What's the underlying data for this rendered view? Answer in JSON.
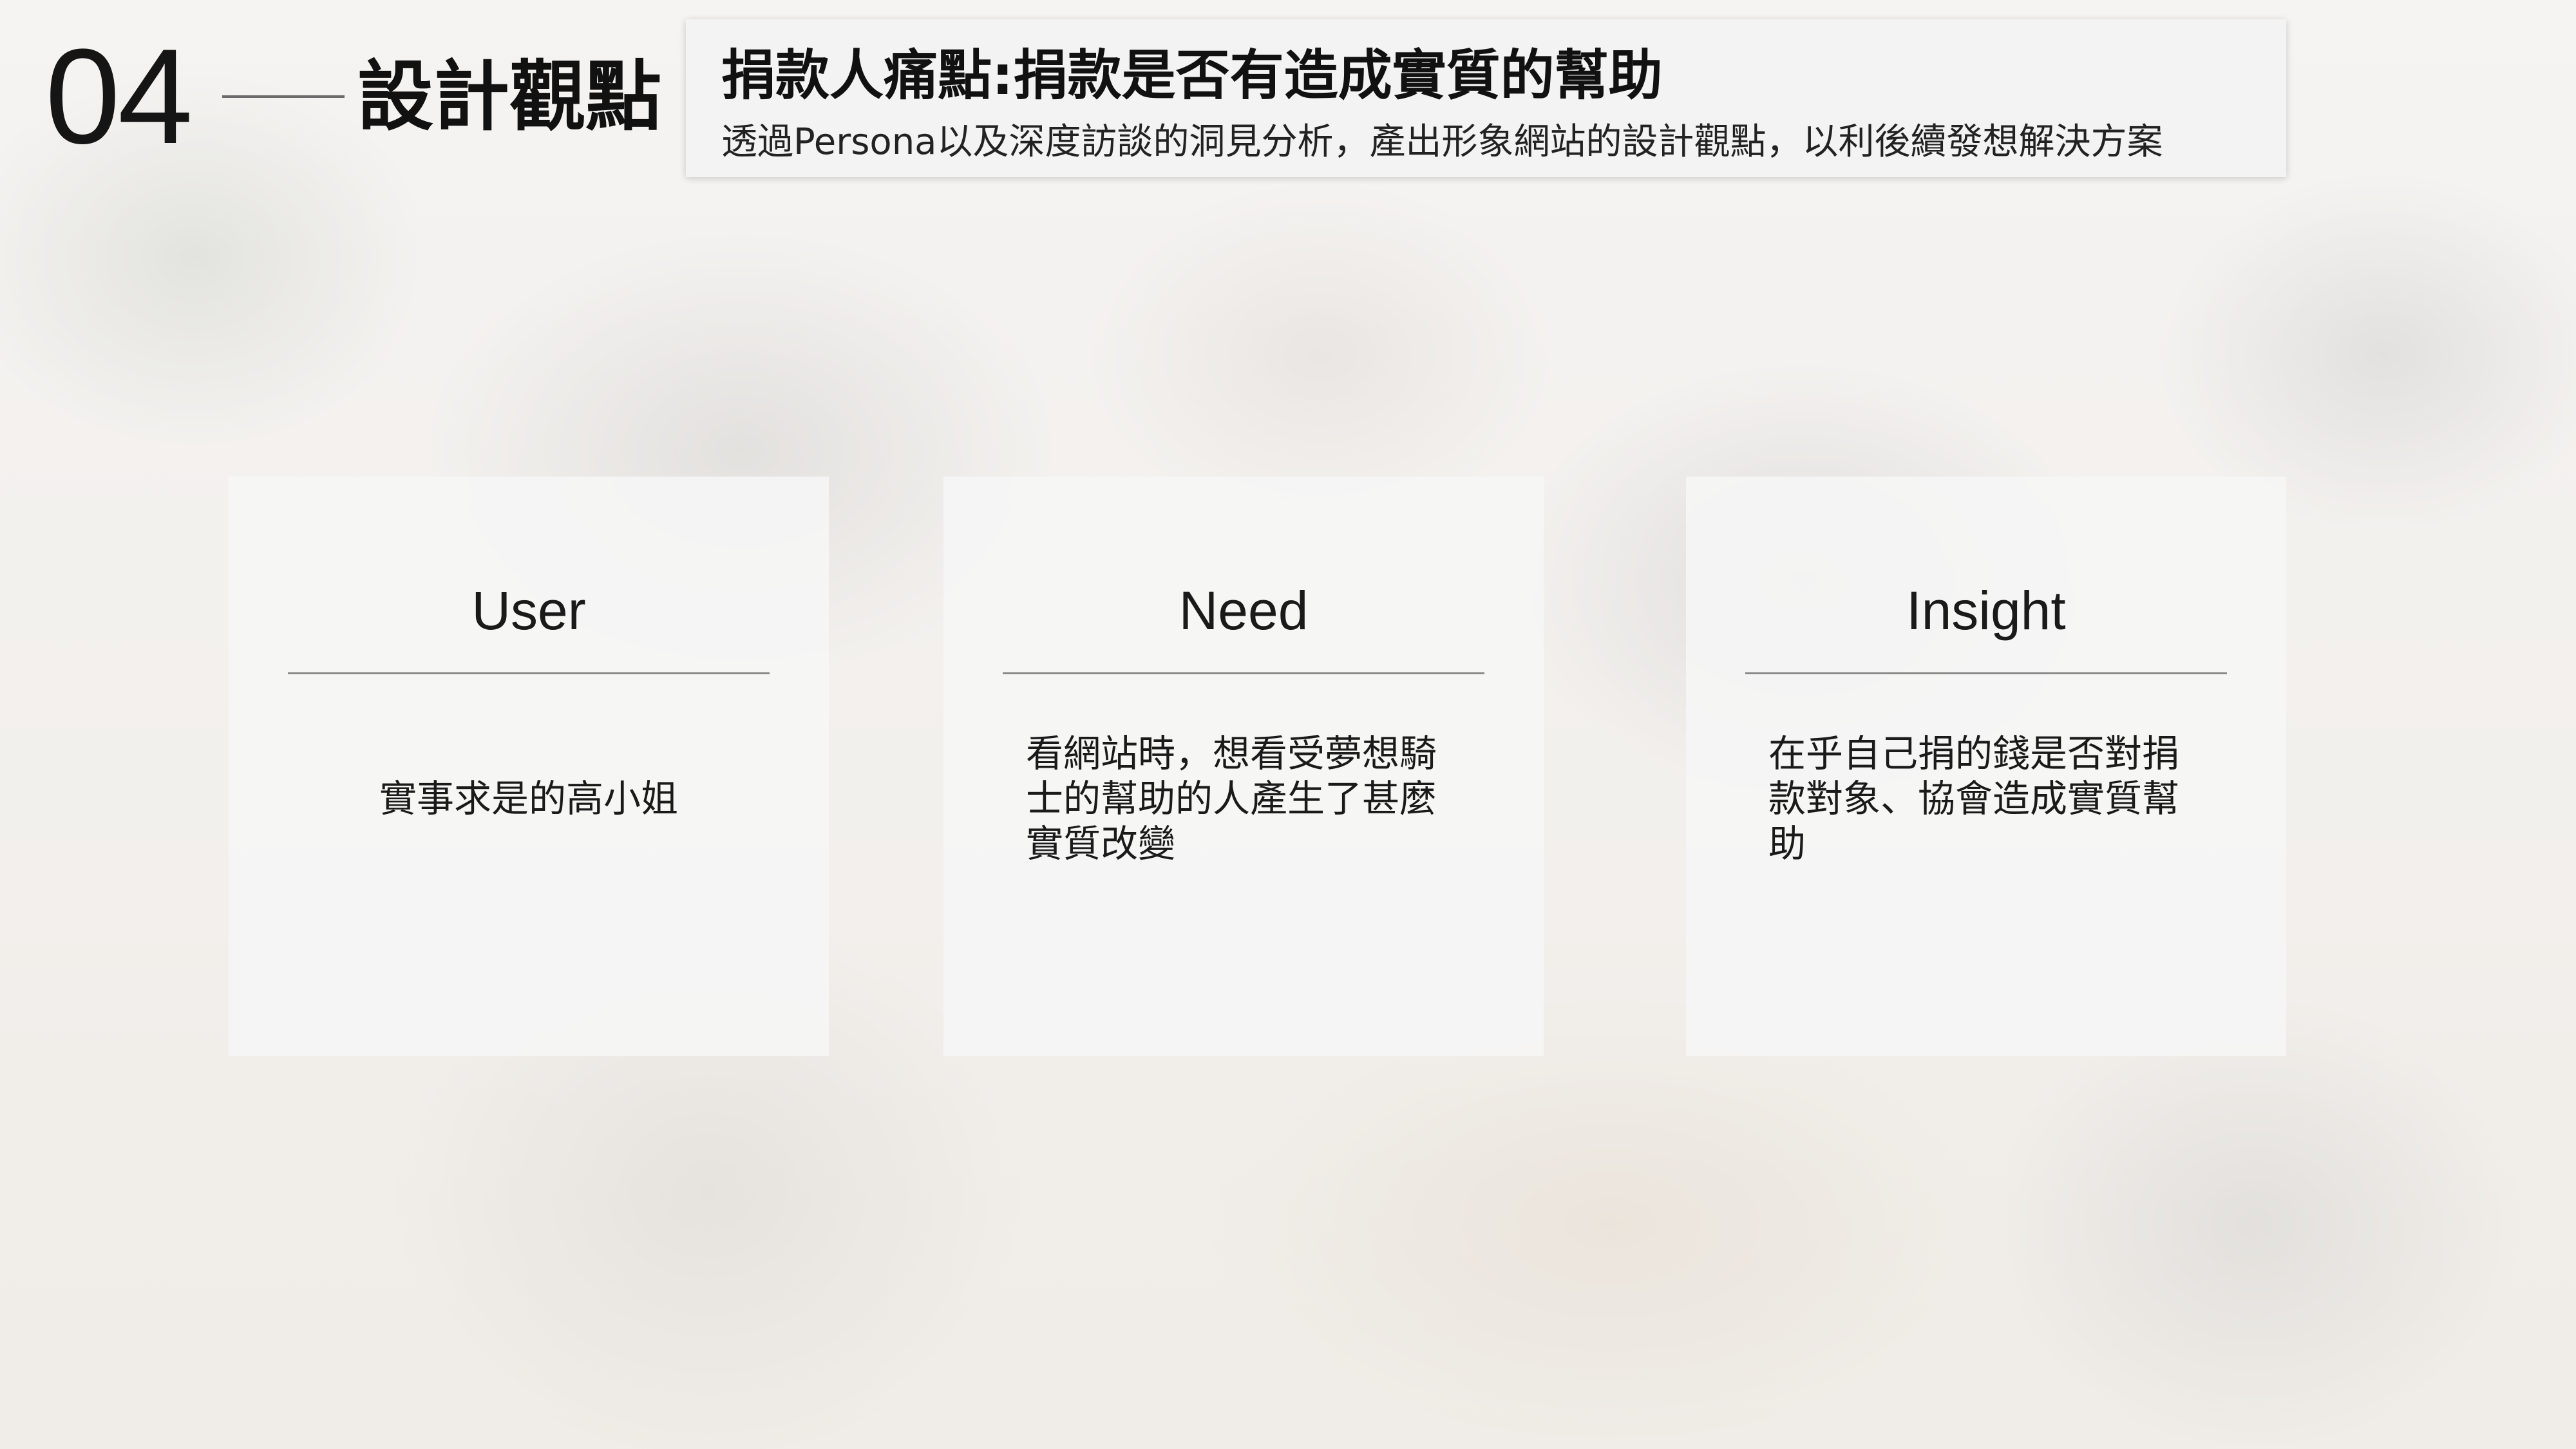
{
  "section": {
    "number": "04",
    "title": "設計觀點"
  },
  "header": {
    "headline": "捐款人痛點:捐款是否有造成實質的幫助",
    "subtitle": "透過Persona以及深度訪談的洞見分析，產出形象網站的設計觀點，以利後續發想解決方案"
  },
  "cards": [
    {
      "title": "User",
      "body": "實事求是的高小姐"
    },
    {
      "title": "Need",
      "body": "看網站時，想看受夢想騎士的幫助的人產生了甚麼實質改變"
    },
    {
      "title": "Insight",
      "body": "在乎自己捐的錢是否對捐款對象、協會造成實質幫助"
    }
  ]
}
